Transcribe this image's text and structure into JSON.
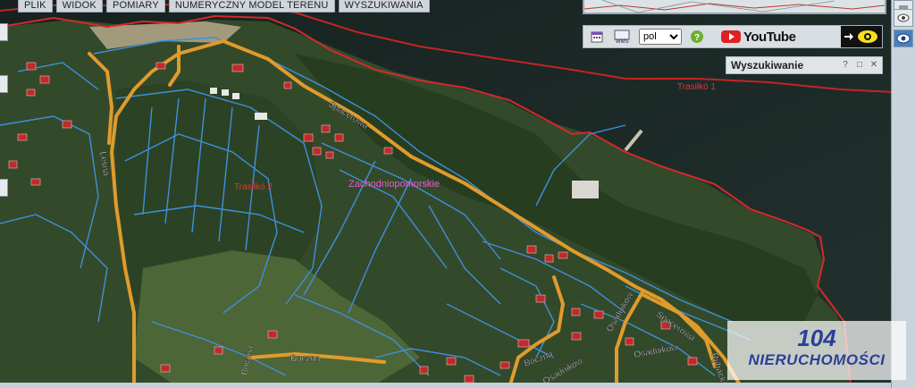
{
  "menu": {
    "items": [
      "PLIK",
      "WIDOK",
      "POMIARY",
      "NUMERYCZNY MODEL TERENU",
      "WYSZUKIWANIA"
    ]
  },
  "map": {
    "region_label": "Zachodniopomorskie",
    "shoreline_labels": [
      "Trasiłkó 1",
      "Trasiłkó 2"
    ],
    "streets": [
      "Spacerowa",
      "Leśna",
      "Boczna",
      "Boczna",
      "Osadników",
      "Osadników",
      "Osadników",
      "Spacerowa",
      "Rybacka",
      "Boczna"
    ],
    "colors": {
      "water": "#1c2b2d",
      "forest": "#2f4a26",
      "parcel_lines": "#3f8fe0",
      "road": "#e09b2d",
      "shore_line": "#d42a2a",
      "region_label": "#e85bd4",
      "shore_label": "#e23333"
    }
  },
  "toolbar": {
    "language_value": "pol",
    "language_options": [
      "pol"
    ],
    "youtube_label": "YouTube",
    "buttons": [
      "calendar-icon",
      "wms-icon",
      "help-icon",
      "youtube-icon",
      "eye-icon"
    ]
  },
  "search_panel": {
    "title": "Wyszukiwanie",
    "buttons": [
      "?",
      "□",
      "✕"
    ]
  },
  "watermark": {
    "number": "104",
    "text": "NIERUCHOMOŚCI"
  }
}
